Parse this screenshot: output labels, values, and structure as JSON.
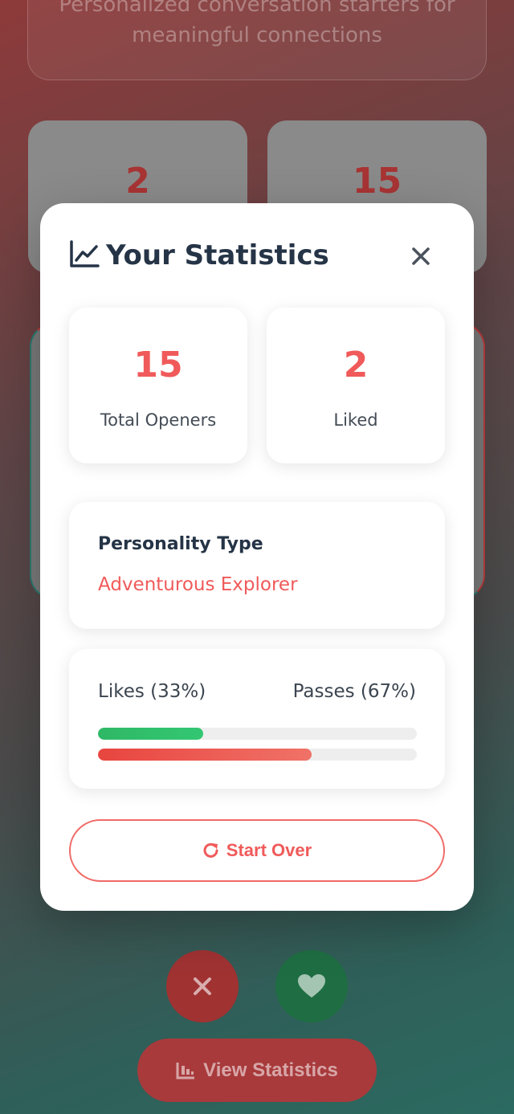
{
  "background": {
    "tagline_line1": "Personalized conversation starters for",
    "tagline_line2": "meaningful connections",
    "stats": {
      "liked": "2",
      "total": "15"
    },
    "view_statistics_label": "View Statistics"
  },
  "modal": {
    "title": "Your Statistics",
    "stats": [
      {
        "value": "15",
        "label": "Total Openers"
      },
      {
        "value": "2",
        "label": "Liked"
      }
    ],
    "personality": {
      "heading": "Personality Type",
      "value": "Adventurous Explorer"
    },
    "ratio": {
      "likes_label": "Likes (33%)",
      "passes_label": "Passes (67%)",
      "likes_percent": 33,
      "passes_percent": 67
    },
    "start_over_label": "Start Over"
  },
  "colors": {
    "accent": "#f05a5a",
    "like_green": "#33c772",
    "pass_red": "#e8453f",
    "text_dark": "#253446"
  },
  "icons": {
    "title": "chart-line-icon",
    "close": "close-icon",
    "restart": "redo-icon",
    "pass": "x-icon",
    "like": "heart-icon",
    "stats": "bar-chart-icon"
  }
}
